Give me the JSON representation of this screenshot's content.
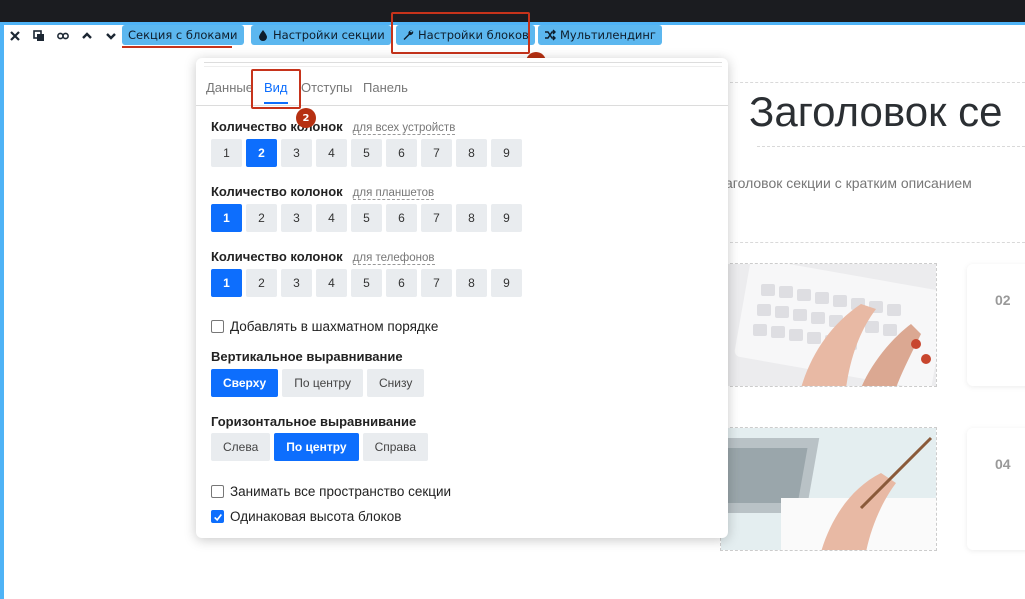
{
  "toolbar": {
    "icons": [
      "close-icon",
      "copy-icon",
      "link-icon",
      "chevron-up-icon",
      "chevron-down-icon"
    ],
    "section_blocks_label": "Секция с блоками",
    "section_settings_label": "Настройки секции",
    "block_settings_label": "Настройки блоков",
    "multilanding_label": "Мультилендинг"
  },
  "annotations": {
    "badge_1": "1",
    "badge_2": "2",
    "accent": "#c6331b"
  },
  "page": {
    "headline": "Заголовок се",
    "subtitle": "аголовок секции с кратким описанием",
    "card_02": "02",
    "card_04": "04"
  },
  "panel": {
    "tabs": [
      "Данные",
      "Вид",
      "Отступы",
      "Панель"
    ],
    "active_tab": "Вид",
    "columns": [
      {
        "title": "Количество колонок",
        "hint": "для всех устройств",
        "options": [
          "1",
          "2",
          "3",
          "4",
          "5",
          "6",
          "7",
          "8",
          "9"
        ],
        "selected": "2"
      },
      {
        "title": "Количество колонок",
        "hint": "для планшетов",
        "options": [
          "1",
          "2",
          "3",
          "4",
          "5",
          "6",
          "7",
          "8",
          "9"
        ],
        "selected": "1"
      },
      {
        "title": "Количество колонок",
        "hint": "для телефонов",
        "options": [
          "1",
          "2",
          "3",
          "4",
          "5",
          "6",
          "7",
          "8",
          "9"
        ],
        "selected": "1"
      }
    ],
    "checker_label": "Добавлять в шахматном порядке",
    "checker_checked": false,
    "vertical": {
      "title": "Вертикальное выравнивание",
      "options": [
        "Сверху",
        "По центру",
        "Снизу"
      ],
      "selected": "Сверху"
    },
    "horizontal": {
      "title": "Горизонтальное выравнивание",
      "options": [
        "Слева",
        "По центру",
        "Справа"
      ],
      "selected": "По центру"
    },
    "fill_label": "Занимать все пространство секции",
    "fill_checked": false,
    "equal_label": "Одинаковая высота блоков",
    "equal_checked": true,
    "accent_color": "#0d6efd"
  }
}
